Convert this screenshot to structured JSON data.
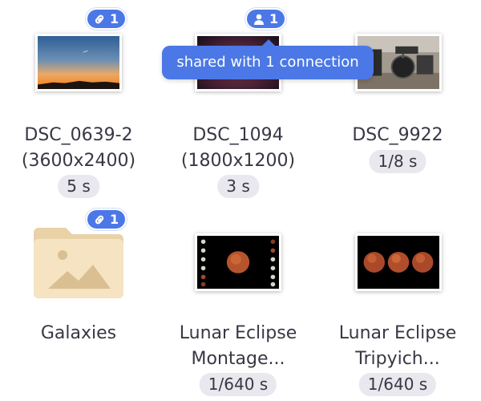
{
  "tooltip": {
    "text": "shared with 1 connection"
  },
  "items": [
    {
      "kind": "photo",
      "badge": {
        "icon": "link-icon",
        "count": "1"
      },
      "name_lines": [
        "DSC_0639-2",
        "(3600x2400)"
      ],
      "exposure": "5 s"
    },
    {
      "kind": "photo",
      "badge": {
        "icon": "person-icon",
        "count": "1"
      },
      "name_lines": [
        "DSC_1094",
        "(1800x1200)"
      ],
      "exposure": "3 s"
    },
    {
      "kind": "photo",
      "badge": null,
      "name_lines": [
        "DSC_9922"
      ],
      "exposure": "1/8 s"
    },
    {
      "kind": "folder",
      "badge": {
        "icon": "link-icon",
        "count": "1"
      },
      "name_lines": [
        "Galaxies"
      ],
      "exposure": null
    },
    {
      "kind": "photo",
      "badge": null,
      "name_lines": [
        "Lunar Eclipse",
        "Montage..."
      ],
      "exposure": "1/640 s"
    },
    {
      "kind": "photo",
      "badge": null,
      "name_lines": [
        "Lunar Eclipse",
        "Tripyich..."
      ],
      "exposure": "1/640 s"
    }
  ],
  "colors": {
    "accent": "#4b78e6",
    "pill_bg": "#e8e8ee",
    "folder": "#f3e0bf"
  }
}
